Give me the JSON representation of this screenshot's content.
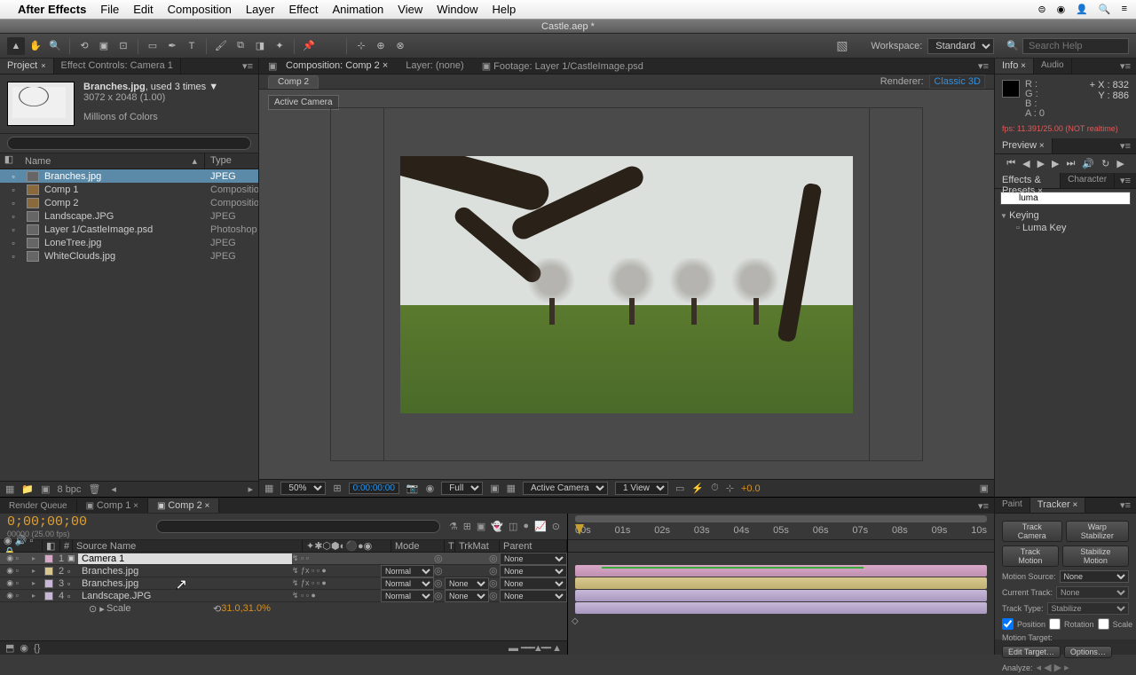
{
  "menubar": {
    "app": "After Effects",
    "items": [
      "File",
      "Edit",
      "Composition",
      "Layer",
      "Effect",
      "Animation",
      "View",
      "Window",
      "Help"
    ]
  },
  "titlebar": "Castle.aep *",
  "workspace": {
    "label": "Workspace:",
    "value": "Standard"
  },
  "search": {
    "placeholder": "Search Help"
  },
  "project": {
    "tab1": "Project",
    "tab2": "Effect Controls: Camera 1",
    "info_name": "Branches.jpg",
    "info_used": ", used 3 times",
    "info_dims": "3072 x 2048 (1.00)",
    "info_colors": "Millions of Colors",
    "col_name": "Name",
    "col_type": "Type",
    "items": [
      {
        "name": "Branches.jpg",
        "type": "JPEG",
        "sel": true,
        "comp": false
      },
      {
        "name": "Comp 1",
        "type": "Composition",
        "sel": false,
        "comp": true
      },
      {
        "name": "Comp 2",
        "type": "Composition",
        "sel": false,
        "comp": true
      },
      {
        "name": "Landscape.JPG",
        "type": "JPEG",
        "sel": false,
        "comp": false
      },
      {
        "name": "Layer 1/CastleImage.psd",
        "type": "Photoshop",
        "sel": false,
        "comp": false
      },
      {
        "name": "LoneTree.jpg",
        "type": "JPEG",
        "sel": false,
        "comp": false
      },
      {
        "name": "WhiteClouds.jpg",
        "type": "JPEG",
        "sel": false,
        "comp": false
      }
    ],
    "bpc": "8 bpc"
  },
  "comp": {
    "tab1": "Composition: Comp 2",
    "tab2": "Layer: (none)",
    "tab3": "Footage: Layer 1/CastleImage.psd",
    "subtab": "Comp 2",
    "renderer_label": "Renderer:",
    "renderer_value": "Classic 3D",
    "active_camera": "Active Camera",
    "footer": {
      "zoom": "50%",
      "timecode": "0:00:00:00",
      "res": "Full",
      "camera": "Active Camera",
      "views": "1 View",
      "exposure": "+0.0"
    }
  },
  "info": {
    "tab1": "Info",
    "tab2": "Audio",
    "r": "R :",
    "g": "G :",
    "b": "B :",
    "a": "A :",
    "a_val": "0",
    "x_label": "X :",
    "x": "832",
    "y_label": "Y :",
    "y": "886",
    "fps": "fps: 11.391/25.00 (NOT realtime)"
  },
  "preview": {
    "title": "Preview"
  },
  "effects": {
    "tab1": "Effects & Presets",
    "tab2": "Character",
    "search": "luma",
    "folder": "Keying",
    "item": "Luma Key"
  },
  "timeline": {
    "tab1": "Render Queue",
    "tab2": "Comp 1",
    "tab3": "Comp 2",
    "tc": "0;00;00;00",
    "tc_sub": "00000 (25.00 fps)",
    "cols": {
      "num": "#",
      "src": "Source Name",
      "mode": "Mode",
      "t": "T",
      "trkmat": "TrkMat",
      "parent": "Parent"
    },
    "layers": [
      {
        "num": "1",
        "name": "Camera 1",
        "color": "#d8a8c8",
        "mode": "",
        "trkmat": "",
        "parent": "None",
        "sel": true,
        "fx": false
      },
      {
        "num": "2",
        "name": "Branches.jpg",
        "color": "#d8c890",
        "mode": "Normal",
        "trkmat": "",
        "parent": "None",
        "sel": false,
        "fx": true
      },
      {
        "num": "3",
        "name": "Branches.jpg",
        "color": "#c8b8d8",
        "mode": "Normal",
        "trkmat": "None",
        "parent": "None",
        "sel": false,
        "fx": true
      },
      {
        "num": "4",
        "name": "Landscape.JPG",
        "color": "#c8b8d8",
        "mode": "Normal",
        "trkmat": "None",
        "parent": "None",
        "sel": false,
        "fx": false
      }
    ],
    "sublayer": {
      "prop": "Scale",
      "val": "31.0,31.0%",
      "link": "⟲"
    },
    "ruler": [
      "00s",
      "01s",
      "02s",
      "03s",
      "04s",
      "05s",
      "06s",
      "07s",
      "08s",
      "09s",
      "10s"
    ]
  },
  "tracker": {
    "tab1": "Paint",
    "tab2": "Tracker",
    "btn_camera": "Track Camera",
    "btn_warp": "Warp Stabilizer",
    "btn_motion": "Track Motion",
    "btn_stab": "Stabilize Motion",
    "src_label": "Motion Source:",
    "src": "None",
    "track_label": "Current Track:",
    "track": "None",
    "type_label": "Track Type:",
    "type": "Stabilize",
    "cb_pos": "Position",
    "cb_rot": "Rotation",
    "cb_scale": "Scale",
    "target_label": "Motion Target:",
    "btn_edit": "Edit Target…",
    "btn_opts": "Options…",
    "btn_analyze": "Analyze:"
  }
}
